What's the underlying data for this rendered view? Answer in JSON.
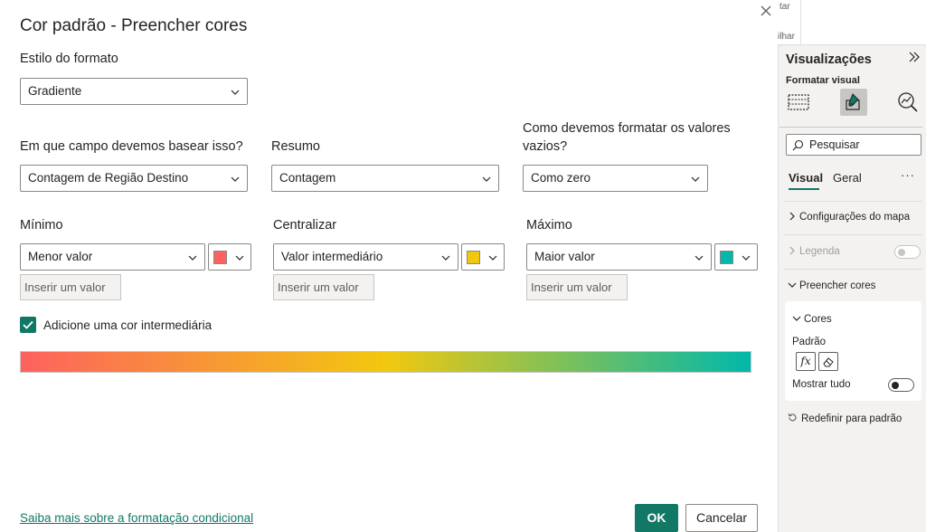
{
  "dialog": {
    "title": "Cor padrão - Preencher cores",
    "format_style_label": "Estilo do formato",
    "format_style_value": "Gradiente",
    "field_label": "Em que campo devemos basear isso?",
    "field_value": "Contagem de Região Destino",
    "summary_label": "Resumo",
    "summary_value": "Contagem",
    "empty_label_line1": "Como devemos formatar os valores",
    "empty_label_line2": "vazios?",
    "empty_value": "Como zero",
    "min": {
      "label": "Mínimo",
      "value": "Menor valor",
      "color": "#fd625e",
      "placeholder": "Inserir um valor"
    },
    "center": {
      "label": "Centralizar",
      "value": "Valor intermediário",
      "color": "#f2c80f",
      "placeholder": "Inserir um valor"
    },
    "max": {
      "label": "Máximo",
      "value": "Maior valor",
      "color": "#01b8aa",
      "placeholder": "Inserir um valor"
    },
    "checkbox_label": "Adicione uma cor intermediária",
    "checkbox_checked": true,
    "link": "Saiba mais sobre a formatação condicional",
    "ok": "OK",
    "cancel": "Cancelar"
  },
  "background_strip": {
    "text1": "tar",
    "text2": "ilhar"
  },
  "pane": {
    "title": "Visualizações",
    "subtitle": "Formatar visual",
    "search_placeholder": "Pesquisar",
    "tab_visual": "Visual",
    "tab_general": "Geral",
    "more": "···",
    "sections": {
      "map_settings": "Configurações do mapa",
      "legend": "Legenda",
      "fill_colors": "Preencher cores",
      "colors": "Cores",
      "default": "Padrão",
      "fx": "fx",
      "show_all": "Mostrar tudo",
      "reset": "Redefinir para padrão"
    },
    "accent": "#117865"
  }
}
